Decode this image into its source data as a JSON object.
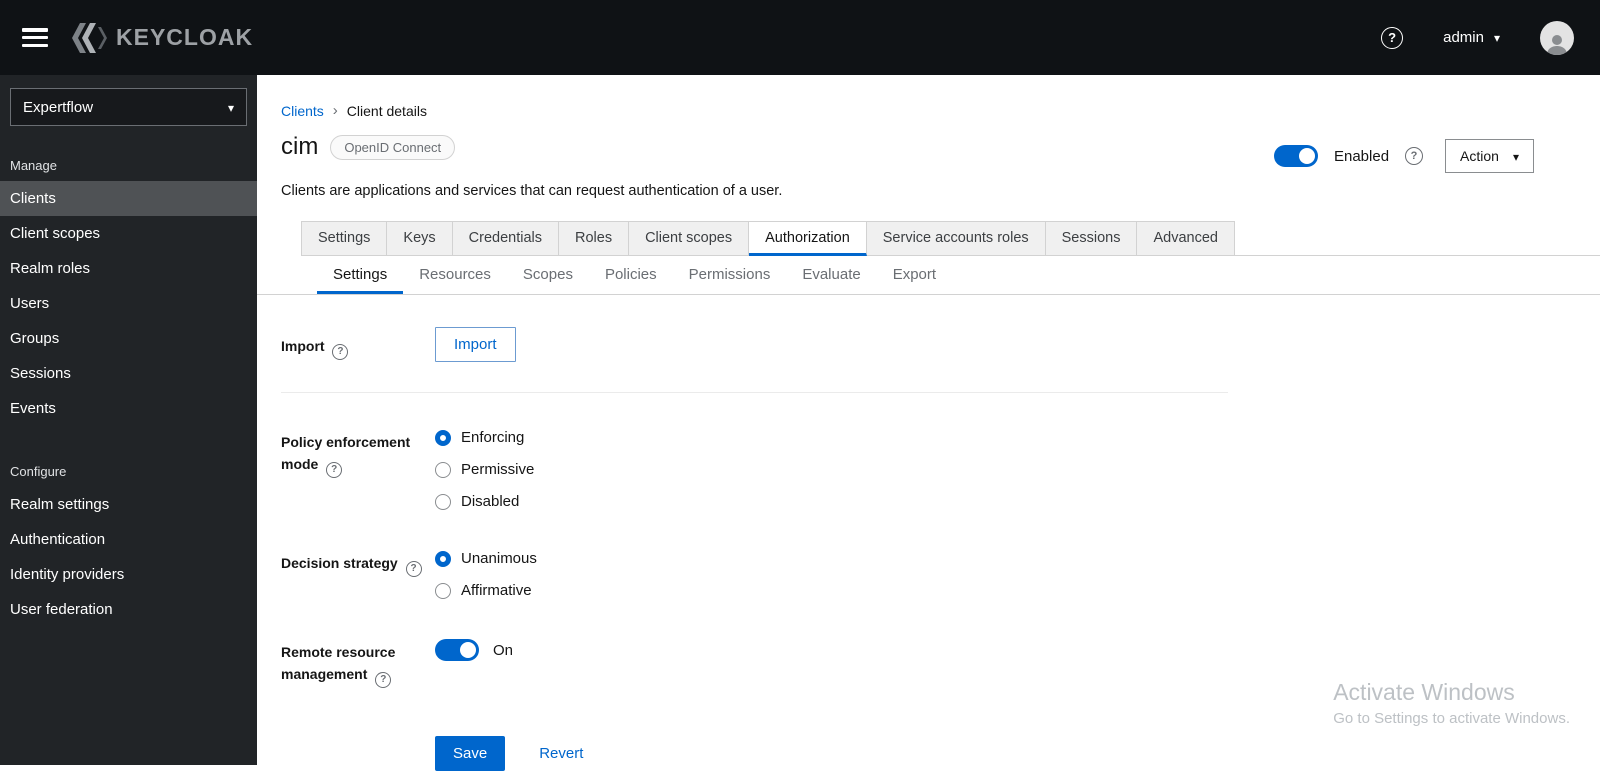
{
  "colors": {
    "accent_blue": "#0066cc",
    "header_bg": "#0f1215",
    "sidebar_bg": "#212427"
  },
  "header": {
    "brand": "KEYCLOAK",
    "user_label": "admin"
  },
  "sidebar": {
    "realm_selector": "Expertflow",
    "manage": {
      "label": "Manage",
      "items": [
        {
          "label": "Clients",
          "active": true
        },
        {
          "label": "Client scopes"
        },
        {
          "label": "Realm roles"
        },
        {
          "label": "Users"
        },
        {
          "label": "Groups"
        },
        {
          "label": "Sessions"
        },
        {
          "label": "Events"
        }
      ]
    },
    "configure": {
      "label": "Configure",
      "items": [
        {
          "label": "Realm settings"
        },
        {
          "label": "Authentication"
        },
        {
          "label": "Identity providers"
        },
        {
          "label": "User federation"
        }
      ]
    }
  },
  "breadcrumb": {
    "root": "Clients",
    "current": "Client details"
  },
  "page_header": {
    "title": "cim",
    "badge": "OpenID Connect",
    "description": "Clients are applications and services that can request authentication of a user.",
    "enabled_label": "Enabled",
    "enabled": true,
    "action_button": "Action"
  },
  "tabs": [
    {
      "label": "Settings"
    },
    {
      "label": "Keys"
    },
    {
      "label": "Credentials"
    },
    {
      "label": "Roles"
    },
    {
      "label": "Client scopes"
    },
    {
      "label": "Authorization",
      "active": true
    },
    {
      "label": "Service accounts roles"
    },
    {
      "label": "Sessions"
    },
    {
      "label": "Advanced"
    }
  ],
  "subtabs": [
    {
      "label": "Settings",
      "active": true
    },
    {
      "label": "Resources"
    },
    {
      "label": "Scopes"
    },
    {
      "label": "Policies"
    },
    {
      "label": "Permissions"
    },
    {
      "label": "Evaluate"
    },
    {
      "label": "Export"
    }
  ],
  "form": {
    "import": {
      "label": "Import",
      "button_label": "Import"
    },
    "policy_enforcement_mode": {
      "label": "Policy enforcement mode",
      "options": [
        {
          "label": "Enforcing"
        },
        {
          "label": "Permissive"
        },
        {
          "label": "Disabled"
        }
      ],
      "selected": "Enforcing"
    },
    "decision_strategy": {
      "label": "Decision strategy",
      "options": [
        {
          "label": "Unanimous"
        },
        {
          "label": "Affirmative"
        }
      ],
      "selected": "Unanimous"
    },
    "remote_resource_management": {
      "label": "Remote resource management",
      "state_label": "On",
      "on": true
    },
    "save_button": "Save",
    "revert_link": "Revert"
  },
  "watermark": {
    "title": "Activate Windows",
    "subtitle": "Go to Settings to activate Windows."
  }
}
